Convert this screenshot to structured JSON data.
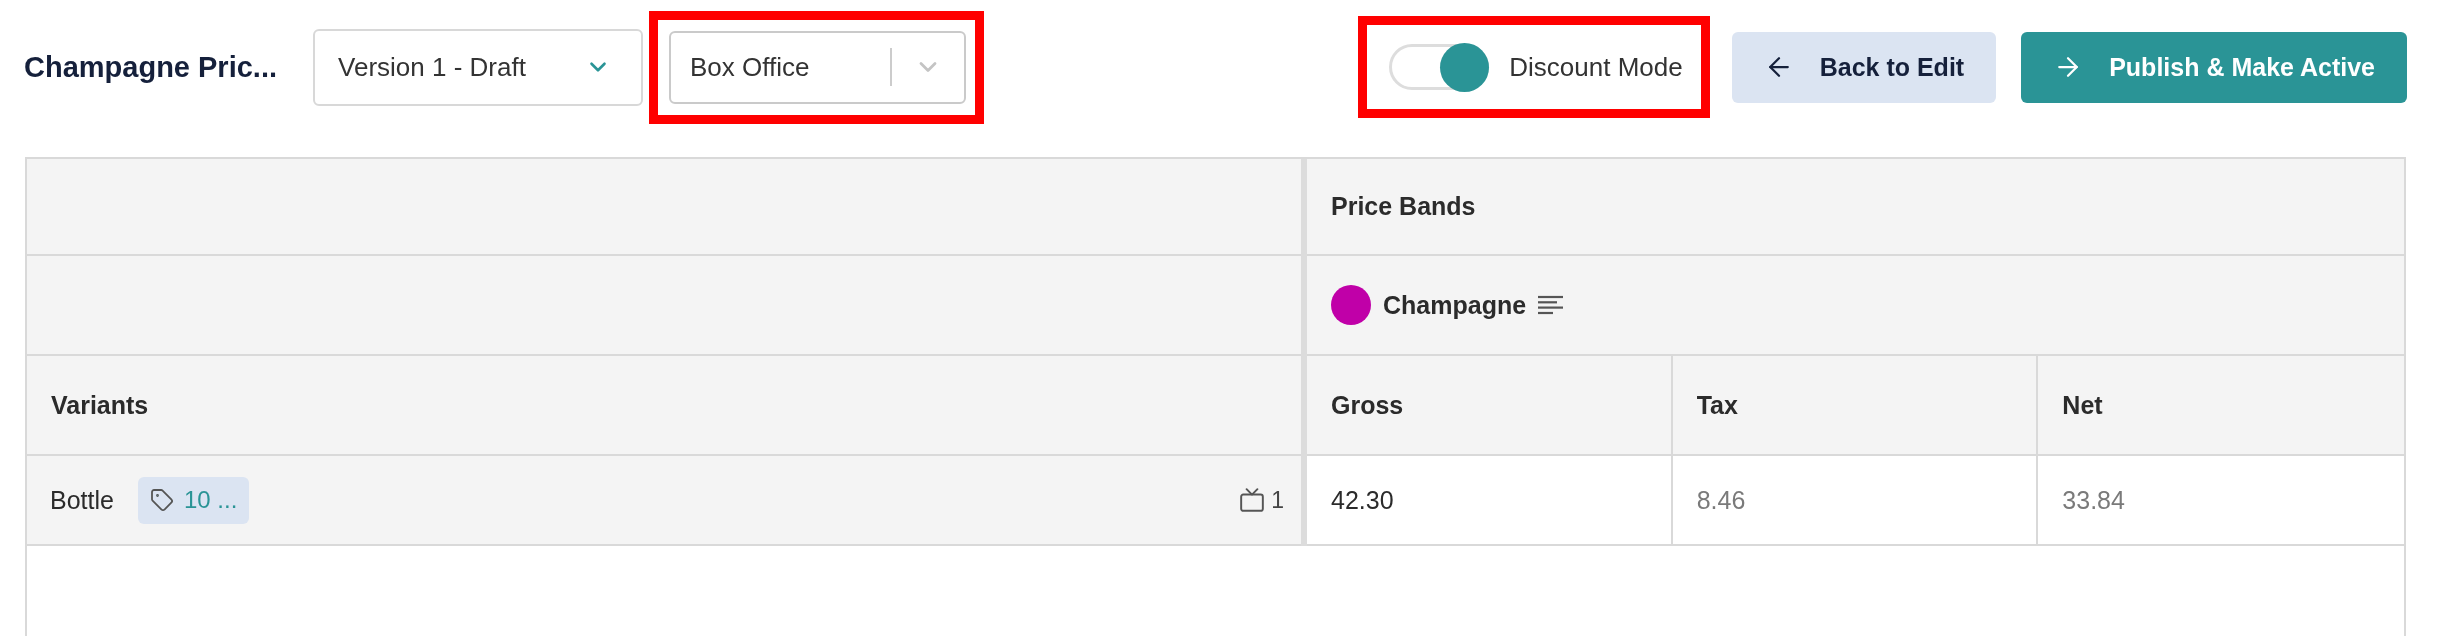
{
  "header": {
    "title": "Champagne Pric...",
    "version_select": {
      "value": "Version 1 - Draft"
    },
    "channel_select": {
      "value": "Box Office",
      "highlighted": true
    },
    "discount_mode": {
      "label": "Discount Mode",
      "on": true,
      "highlighted": true
    },
    "buttons": [
      {
        "label": "Back to Edit",
        "kind": "secondary"
      },
      {
        "label": "Publish & Make Active",
        "kind": "primary"
      }
    ]
  },
  "table": {
    "group_header": "Price Bands",
    "band": {
      "name": "Champagne",
      "color": "#c000a8"
    },
    "variants_header": "Variants",
    "columns": [
      "Gross",
      "Tax",
      "Net"
    ],
    "rows": [
      {
        "variant": "Bottle",
        "tag": "10 ...",
        "count": "1",
        "cells": [
          {
            "value": "42.30",
            "muted": false
          },
          {
            "value": "8.46",
            "muted": true
          },
          {
            "value": "33.84",
            "muted": true
          }
        ]
      }
    ]
  }
}
